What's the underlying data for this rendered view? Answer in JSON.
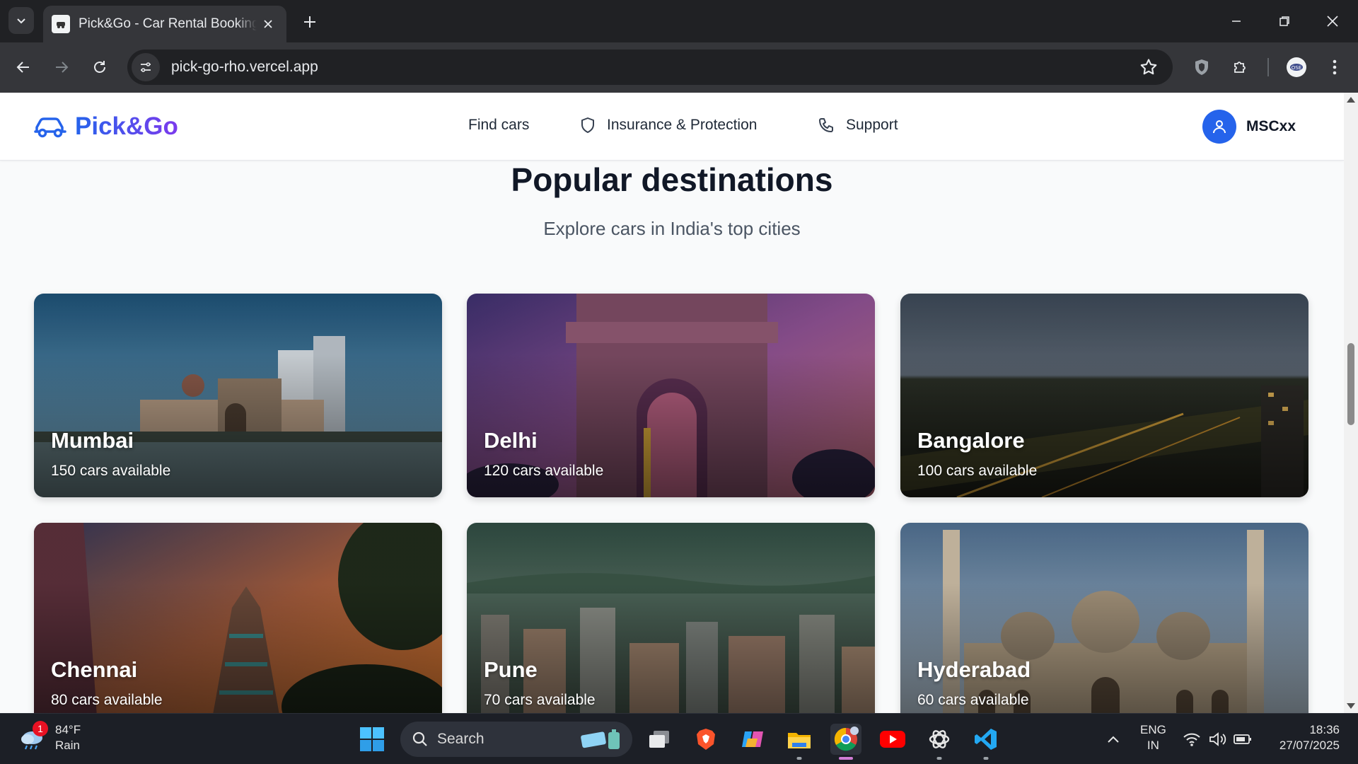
{
  "browser": {
    "tab_title": "Pick&Go - Car Rental Booking Platform",
    "url": "pick-go-rho.vercel.app"
  },
  "header": {
    "logo": "Pick&Go",
    "nav": [
      {
        "label": "Find cars",
        "icon": "none"
      },
      {
        "label": "Insurance & Protection",
        "icon": "shield-icon"
      },
      {
        "label": "Support",
        "icon": "phone-icon"
      }
    ],
    "user": {
      "name": "MSCxx",
      "icon": "user-icon"
    }
  },
  "destinations": {
    "title": "Popular destinations",
    "subtitle": "Explore cars in India's top cities",
    "cards": [
      {
        "city": "Mumbai",
        "count": "150 cars available"
      },
      {
        "city": "Delhi",
        "count": "120 cars available"
      },
      {
        "city": "Bangalore",
        "count": "100 cars available"
      },
      {
        "city": "Chennai",
        "count": "80 cars available"
      },
      {
        "city": "Pune",
        "count": "70 cars available"
      },
      {
        "city": "Hyderabad",
        "count": "60 cars available"
      }
    ]
  },
  "taskbar": {
    "weather": {
      "temp": "84°F",
      "condition": "Rain",
      "badge": "1"
    },
    "search_label": "Search",
    "language": {
      "line1": "ENG",
      "line2": "IN"
    },
    "time": "18:36",
    "date": "27/07/2025"
  },
  "colors": {
    "brand_blue": "#2563eb",
    "brand_purple": "#7c3aed",
    "page_bg": "#f9fafb",
    "chrome_dark": "#202124",
    "chrome_toolbar": "#35363a"
  }
}
